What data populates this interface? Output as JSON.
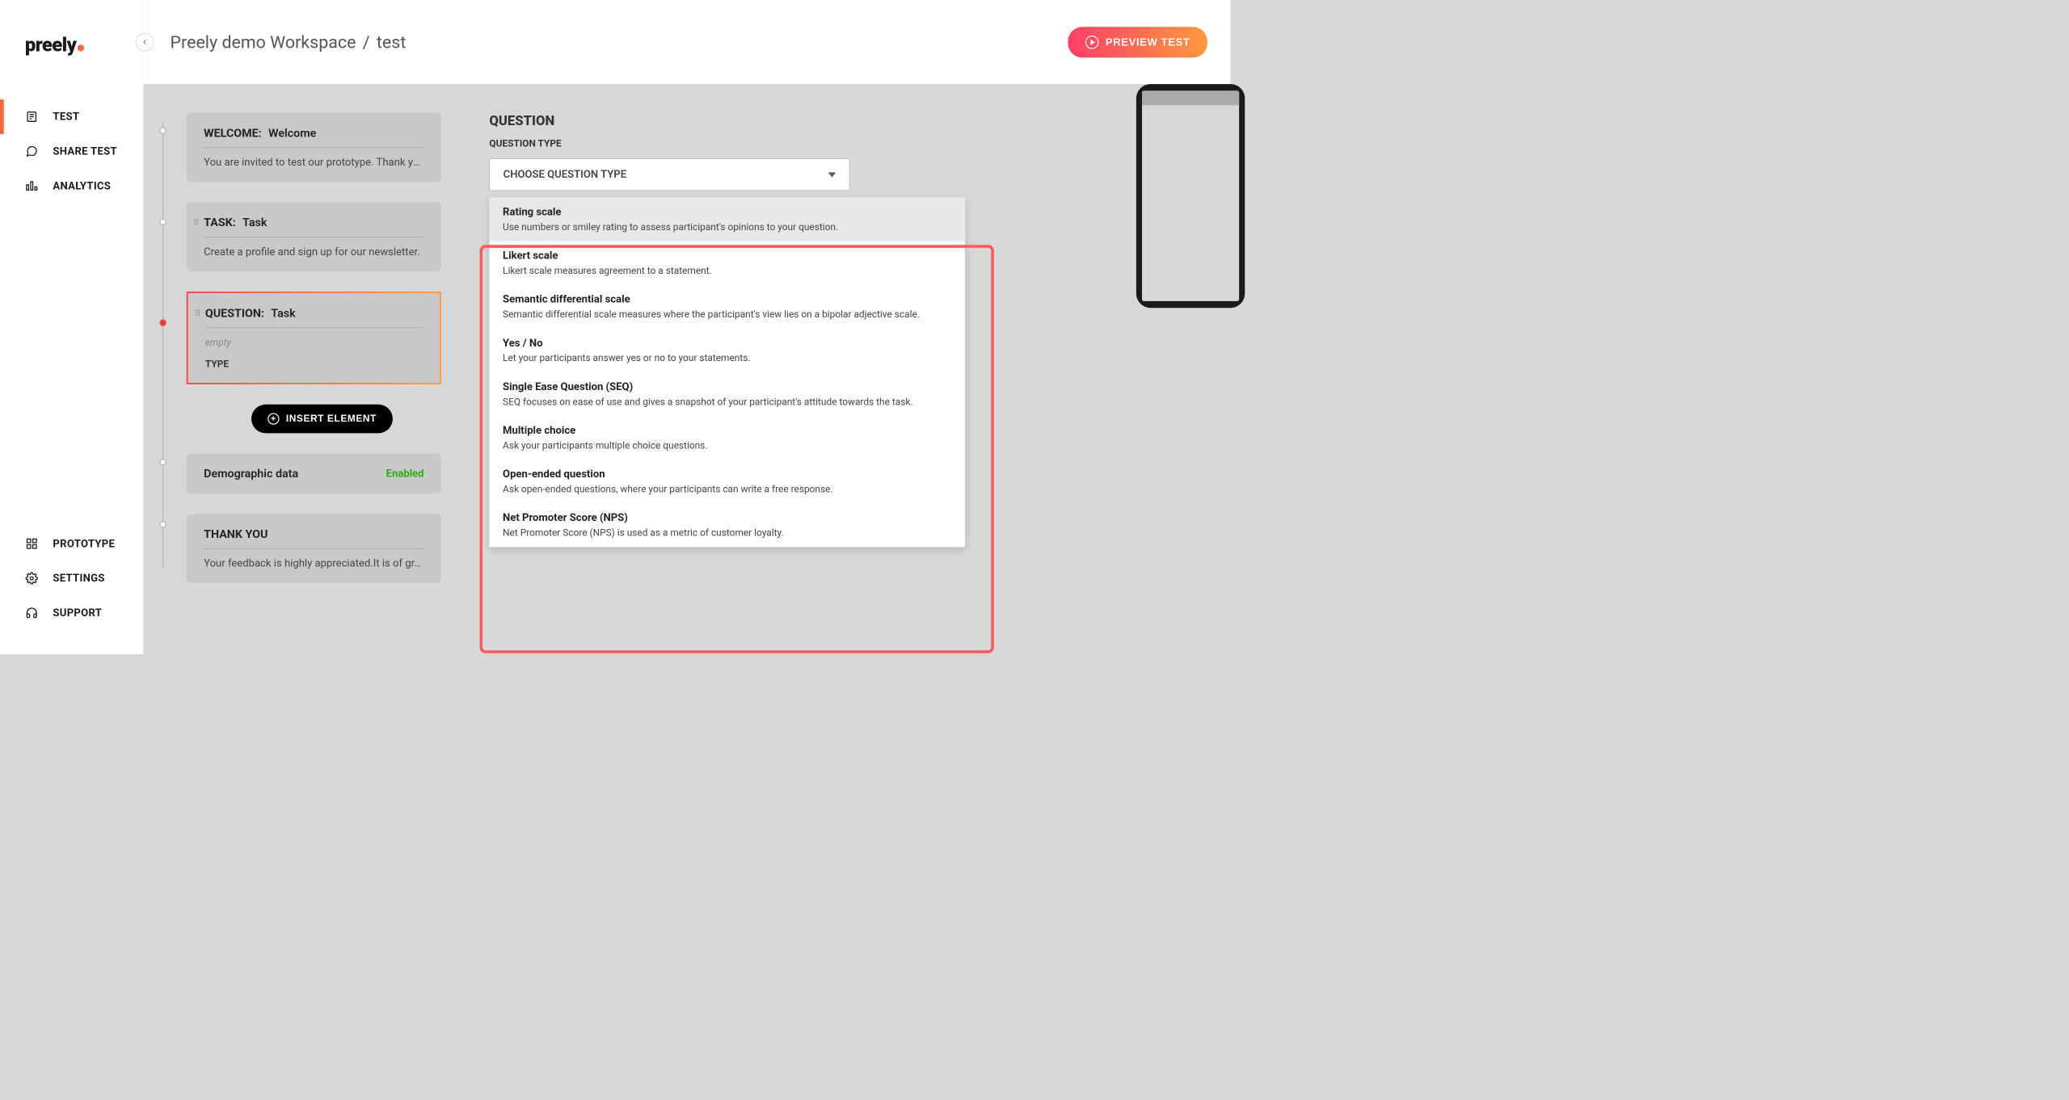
{
  "logo": "preely",
  "nav": {
    "items": [
      {
        "label": "TEST",
        "active": true
      },
      {
        "label": "SHARE TEST",
        "active": false
      },
      {
        "label": "ANALYTICS",
        "active": false
      }
    ],
    "bottom": [
      {
        "label": "PROTOTYPE"
      },
      {
        "label": "SETTINGS"
      },
      {
        "label": "SUPPORT"
      }
    ]
  },
  "breadcrumb": {
    "workspace": "Preely demo Workspace",
    "sep": "/",
    "current": "test"
  },
  "preview_btn": "PREVIEW TEST",
  "steps": {
    "welcome": {
      "label": "WELCOME:",
      "name": "Welcome",
      "desc": "You are invited to test our prototype. Thank yo…"
    },
    "task": {
      "label": "TASK:",
      "name": "Task",
      "desc": "Create a profile and sign up for our newsletter."
    },
    "question": {
      "label": "QUESTION:",
      "name": "Task",
      "empty": "empty",
      "type_label": "TYPE"
    },
    "insert_btn": "INSERT ELEMENT",
    "demographic": {
      "label": "Demographic data",
      "status": "Enabled"
    },
    "thankyou": {
      "label": "THANK YOU",
      "desc": "Your feedback is highly appreciated.It is of gr…"
    }
  },
  "editor": {
    "heading": "QUESTION",
    "subheading": "QUESTION TYPE",
    "select_placeholder": "CHOOSE QUESTION TYPE",
    "options": [
      {
        "title": "Rating scale",
        "desc": "Use numbers or smiley rating to assess participant's opinions to your question.",
        "hovered": true
      },
      {
        "title": "Likert scale",
        "desc": "Likert scale measures agreement to a statement."
      },
      {
        "title": "Semantic differential scale",
        "desc": "Semantic differential scale measures where the participant's view lies on a bipolar adjective scale."
      },
      {
        "title": "Yes / No",
        "desc": "Let your participants answer yes or no to your statements."
      },
      {
        "title": "Single Ease Question (SEQ)",
        "desc": "SEQ focuses on ease of use and gives a snapshot of your participant's attitude towards the task."
      },
      {
        "title": "Multiple choice",
        "desc": "Ask your participants multiple choice questions."
      },
      {
        "title": "Open-ended question",
        "desc": "Ask open-ended questions, where your participants can write a free response."
      },
      {
        "title": "Net Promoter Score (NPS)",
        "desc": "Net Promoter Score (NPS) is used as a metric of customer loyalty."
      }
    ]
  }
}
